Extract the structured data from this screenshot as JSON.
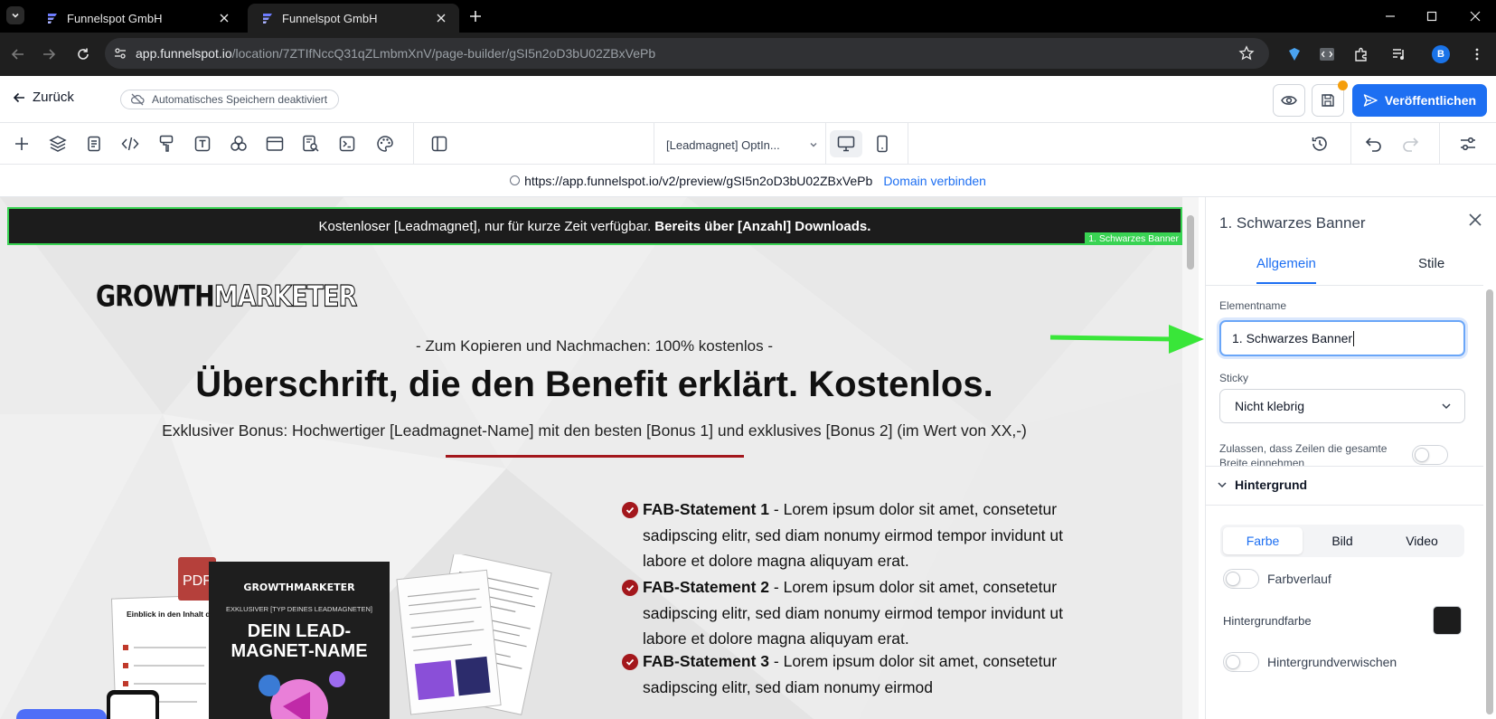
{
  "browser": {
    "tabs": [
      {
        "title": "Funnelspot GmbH",
        "active": false
      },
      {
        "title": "Funnelspot GmbH",
        "active": true
      }
    ],
    "url_host": "app.funnelspot.io",
    "url_path": "/location/7ZTIfNccQ31qZLmbmXnV/page-builder/gSI5n2oD3bU02ZBxVePb",
    "profile_initial": "B"
  },
  "header": {
    "back_label": "Zurück",
    "autosave_label": "Automatisches Speichern deaktiviert",
    "publish_label": "Veröffentlichen"
  },
  "toolbar": {
    "page_select": "[Leadmagnet] OptIn...",
    "tools": [
      "add-icon",
      "layers-icon",
      "pages-icon",
      "code-icon",
      "paint-icon",
      "text-icon",
      "elements-icon",
      "sections-icon",
      "seo-icon",
      "terminal-icon",
      "palette-icon",
      "split-view-icon"
    ]
  },
  "preview": {
    "url": "https://app.funnelspot.io/v2/preview/gSI5n2oD3bU02ZBxVePb",
    "connect_label": "Domain verbinden"
  },
  "canvas": {
    "banner_text": "Kostenloser [Leadmagnet], nur für kurze Zeit verfügbar.",
    "banner_bold": "Bereits über [Anzahl] Downloads.",
    "banner_tag": "1. Schwarzes Banner",
    "logo_part1": "GROWTH",
    "logo_part2": "MARKETER",
    "subline": "- Zum Kopieren und Nachmachen: 100% kostenlos -",
    "headline": "Überschrift, die den Benefit erklärt. Kostenlos.",
    "bonus": "Exklusiver Bonus: Hochwertiger [Leadmagnet-Name] mit den besten [Bonus 1] und exklusives [Bonus 2] (im Wert von XX,-)",
    "fab_items": [
      {
        "label": "FAB-Statement 1",
        "text": " - Lorem ipsum dolor sit amet, consetetur sadipscing elitr, sed diam nonumy eirmod tempor invidunt ut labore et dolore magna aliquyam erat."
      },
      {
        "label": "FAB-Statement 2",
        "text": " - Lorem ipsum dolor sit amet, consetetur sadipscing elitr, sed diam nonumy eirmod tempor invidunt ut labore et dolore magna aliquyam erat."
      },
      {
        "label": "FAB-Statement 3",
        "text": " - Lorem ipsum dolor sit amet, consetetur sadipscing elitr, sed diam nonumy eirmod"
      }
    ],
    "mockup": {
      "pdf_label": "PDF",
      "page_title": "Einblick in den Inhalt deines Leadmagneten",
      "book_logo": "GROWTHMARKETER",
      "book_kicker": "EXKLUSIVER [TYP DEINES LEADMAGNETEN]",
      "book_title_1": "DEIN LEAD-",
      "book_title_2": "MAGNET-NAME"
    }
  },
  "panel": {
    "title": "1. Schwarzes Banner",
    "tab_general": "Allgemein",
    "tab_styles": "Stile",
    "element_name_label": "Elementname",
    "element_name_value": "1. Schwarzes Banner",
    "sticky_label": "Sticky",
    "sticky_value": "Nicht klebrig",
    "fullwidth_label": "Zulassen, dass Zeilen die gesamte Breite einnehmen",
    "background_section": "Hintergrund",
    "bg_options": [
      "Farbe",
      "Bild",
      "Video"
    ],
    "gradient_label": "Farbverlauf",
    "bg_color_label": "Hintergrundfarbe",
    "bg_color": "#1c1c1c",
    "blur_label": "Hintergrundverwischen"
  },
  "colors": {
    "accent": "#1d6ff2",
    "selection": "#39d353",
    "brand_red": "#a3171c"
  }
}
